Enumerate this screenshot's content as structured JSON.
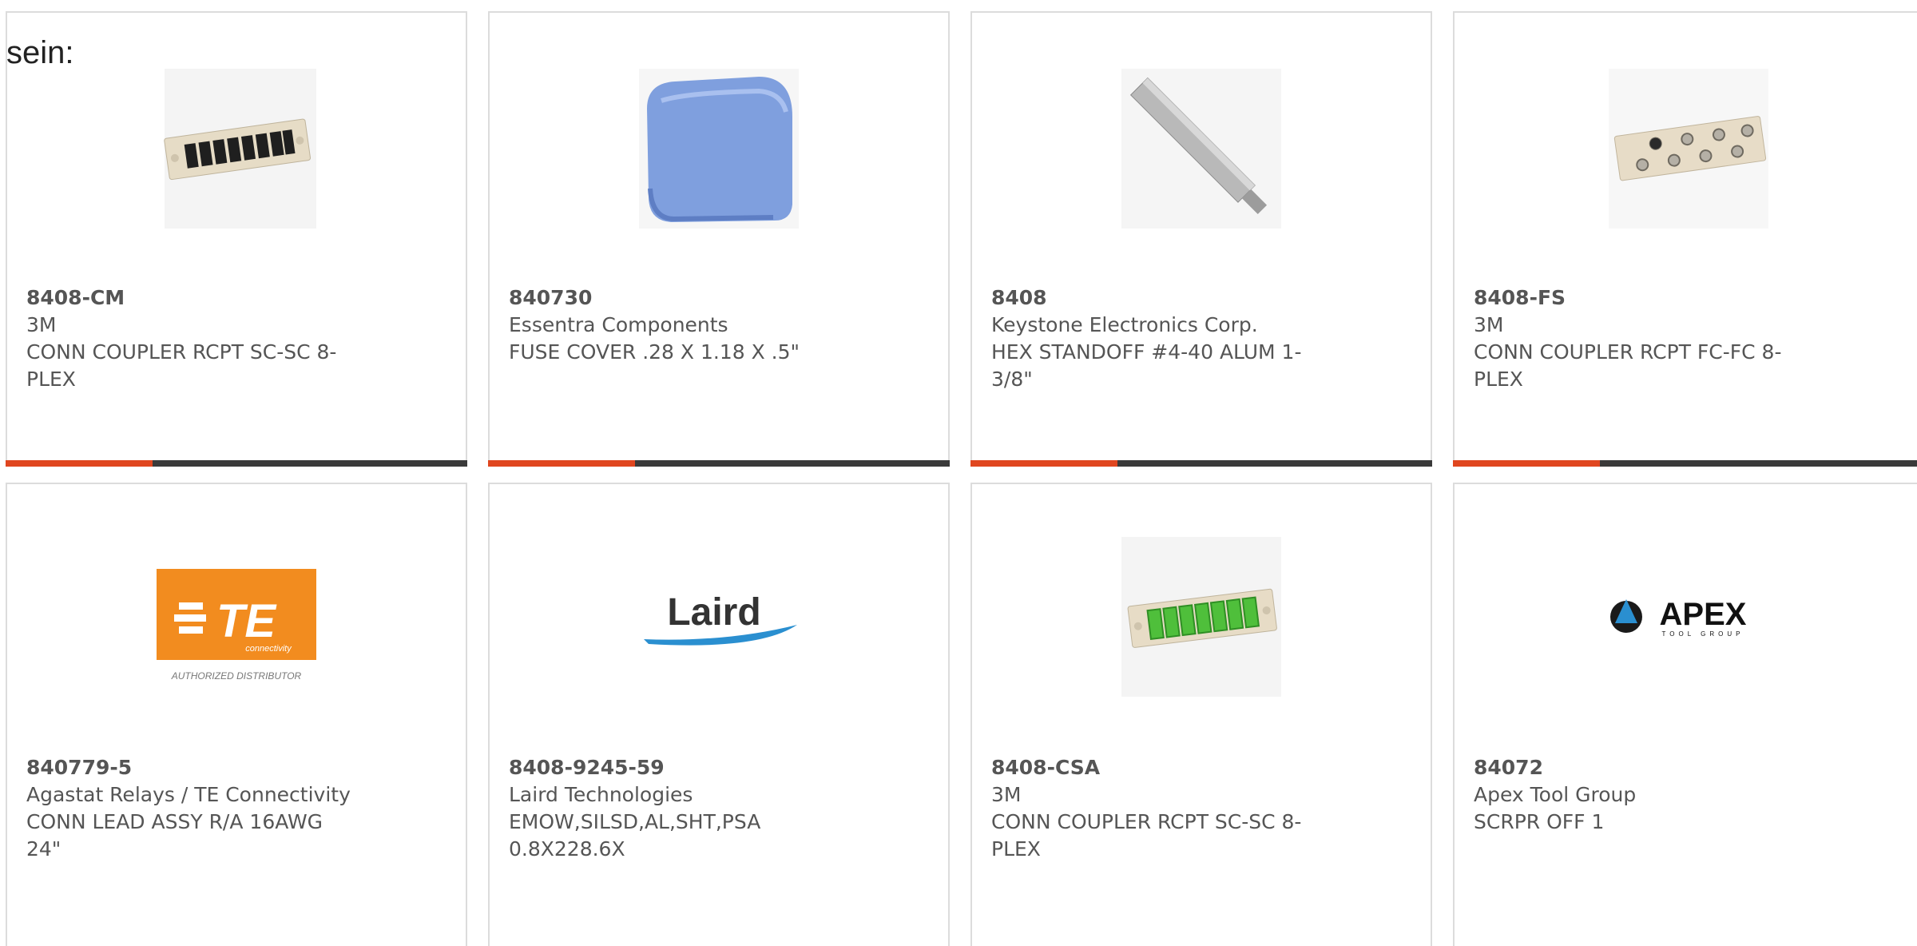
{
  "lead_text": "sein:",
  "colors": {
    "accent": "#e0461f",
    "bar": "#3a3a3a",
    "border": "#dcdcdc"
  },
  "products": [
    {
      "part": "8408-CM",
      "maker": "3M",
      "desc": "CONN COUPLER RCPT SC-SC 8-PLEX",
      "image": "sc-coupler-plate-black"
    },
    {
      "part": "840730",
      "maker": "Essentra Components",
      "desc": "FUSE COVER .28 X 1.18 X .5\"",
      "image": "blue-fuse-cover"
    },
    {
      "part": "8408",
      "maker": "Keystone Electronics Corp.",
      "desc": "HEX STANDOFF #4-40 ALUM 1-3/8\"",
      "image": "hex-standoff"
    },
    {
      "part": "8408-FS",
      "maker": "3M",
      "desc": "CONN COUPLER RCPT FC-FC 8-PLEX",
      "image": "fc-coupler-plate"
    },
    {
      "part": "840779-5",
      "maker": "Agastat Relays / TE Connectivity",
      "desc": "CONN LEAD ASSY R/A 16AWG 24\"",
      "image": "te-connectivity-logo",
      "logo": {
        "mark": "TE",
        "tagline": "connectivity",
        "caption": "AUTHORIZED DISTRIBUTOR"
      }
    },
    {
      "part": "8408-9245-59",
      "maker": "Laird Technologies",
      "desc": "EMOW,SILSD,AL,SHT,PSA 0.8X228.6X",
      "image": "laird-logo",
      "logo": {
        "mark": "Laird"
      }
    },
    {
      "part": "8408-CSA",
      "maker": "3M",
      "desc": "CONN COUPLER RCPT SC-SC 8-PLEX",
      "image": "sc-coupler-plate-green"
    },
    {
      "part": "84072",
      "maker": "Apex Tool Group",
      "desc": "SCRPR OFF 1",
      "image": "apex-logo",
      "logo": {
        "mark": "APEX",
        "tagline": "TOOL GROUP"
      }
    }
  ]
}
